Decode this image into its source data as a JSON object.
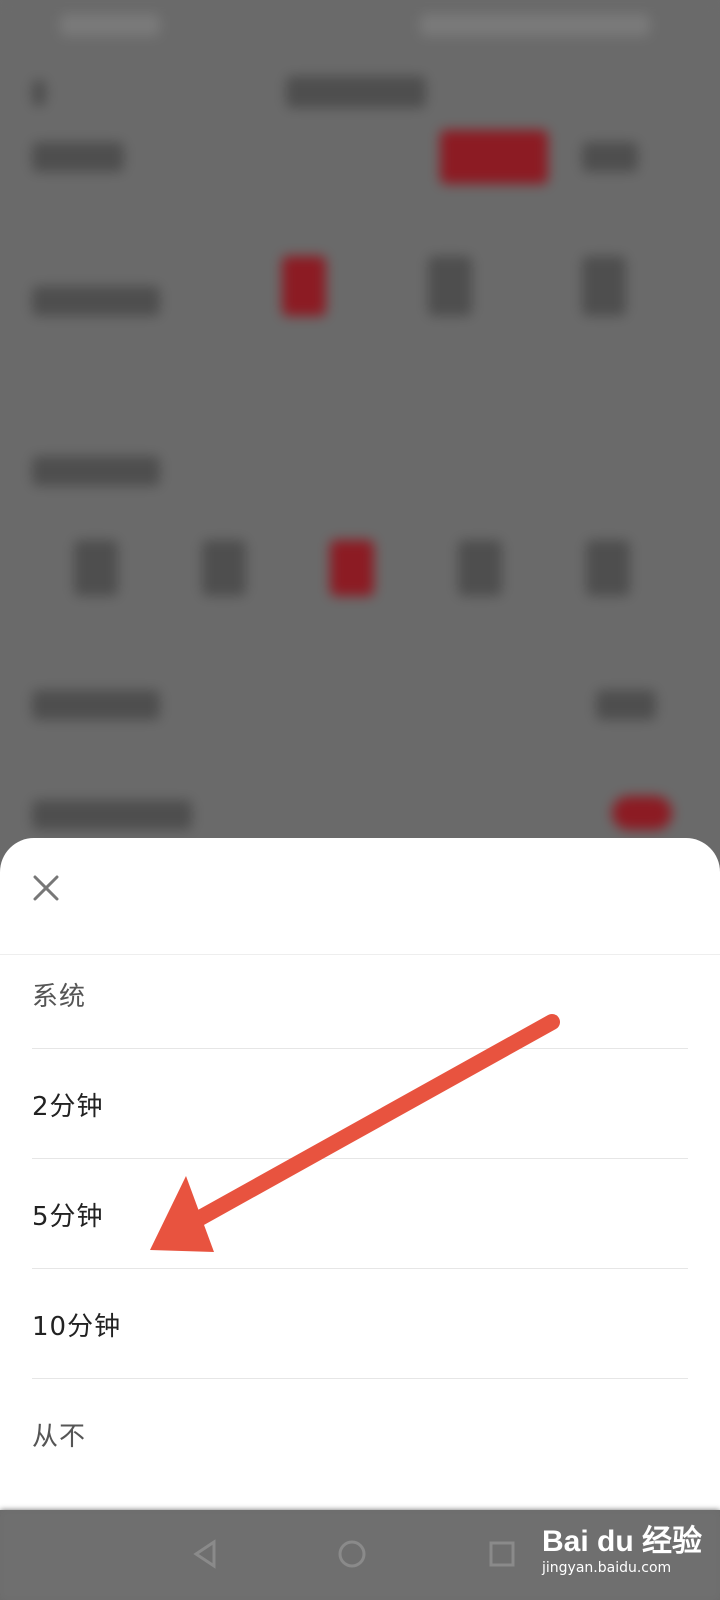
{
  "sheet": {
    "options": [
      {
        "label": "系统"
      },
      {
        "label": "2分钟"
      },
      {
        "label": "5分钟"
      },
      {
        "label": "10分钟"
      },
      {
        "label": "从不"
      }
    ]
  },
  "watermark": {
    "brand": "Bai du 经验",
    "url": "jingyan.baidu.com"
  },
  "colors": {
    "accent": "#e8533f",
    "sheet_bg": "#ffffff",
    "overlay": "#6b6b6b"
  }
}
